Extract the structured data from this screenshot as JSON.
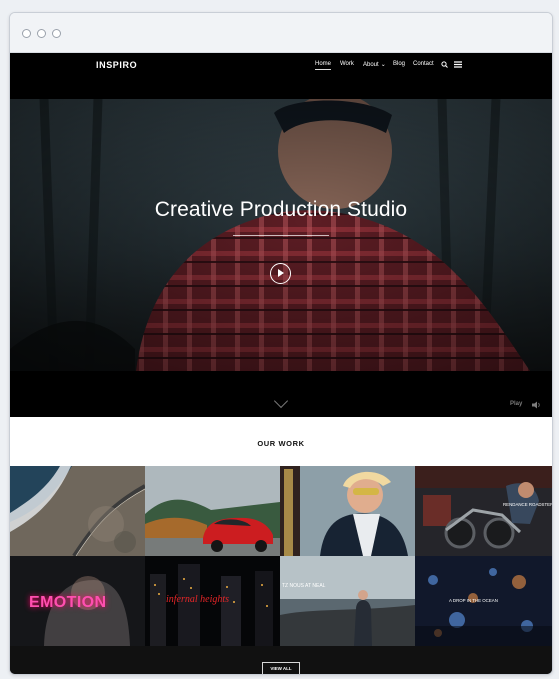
{
  "site": {
    "logo": "INSPIRO",
    "nav": [
      "Home",
      "Work",
      "About",
      "Blog",
      "Contact"
    ],
    "about_arrow": "⌄"
  },
  "hero": {
    "title": "Creative Production Studio",
    "play_label": "Play"
  },
  "section": {
    "title": "OUR WORK",
    "view_all": "VIEW ALL"
  },
  "tiles": [
    {
      "text": ""
    },
    {
      "text": ""
    },
    {
      "text": ""
    },
    {
      "text": "RENDANCE ROADSTER"
    },
    {
      "text": "EMOTION"
    },
    {
      "text": "infernal heights"
    },
    {
      "text": "TZ NOUS AT NEAL"
    },
    {
      "text": "A DROP IN THE OCEAN"
    }
  ],
  "icons": {
    "search": "search-icon",
    "menu": "menu-icon",
    "play": "play-icon",
    "chevron": "chevron-down-icon",
    "sound": "sound-icon"
  }
}
